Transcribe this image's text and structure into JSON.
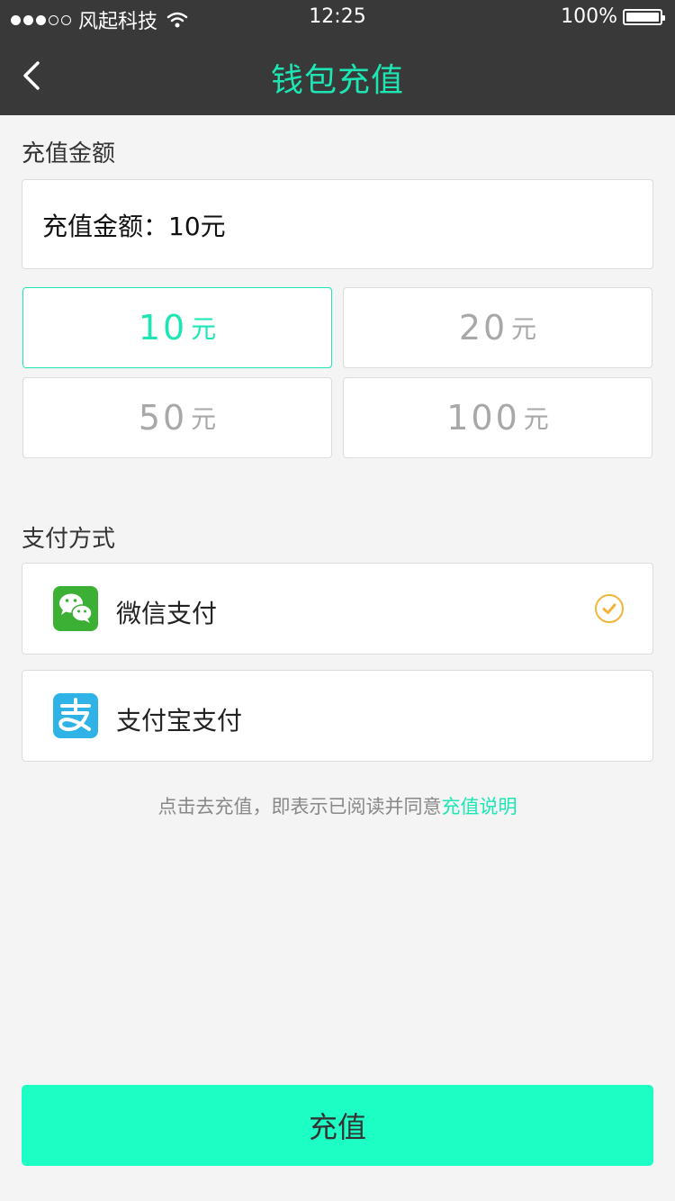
{
  "status_bar": {
    "carrier": "风起科技",
    "time": "12:25",
    "battery": "100%"
  },
  "nav": {
    "title": "钱包充值",
    "back_icon": "chevron-left-icon"
  },
  "amount_section": {
    "label": "充值金额",
    "current_amount": "充值金额：10元",
    "options": [
      {
        "value": "10",
        "unit": "元",
        "selected": true
      },
      {
        "value": "20",
        "unit": "元",
        "selected": false
      },
      {
        "value": "50",
        "unit": "元",
        "selected": false
      },
      {
        "value": "100",
        "unit": "元",
        "selected": false
      }
    ]
  },
  "payment_section": {
    "label": "支付方式",
    "methods": [
      {
        "label": "微信支付",
        "icon": "wechat-icon",
        "selected": true
      },
      {
        "label": "支付宝支付",
        "icon": "alipay-icon",
        "selected": false
      }
    ]
  },
  "agreement": {
    "text": "点击去充值，即表示已阅读并同意",
    "link": "充值说明"
  },
  "submit": {
    "label": "充值"
  },
  "colors": {
    "accent": "#1de6b4",
    "button": "#1dfec4",
    "header": "#393939",
    "check": "#f4b43a",
    "wechat": "#3cb034",
    "alipay": "#2fb2e6"
  }
}
